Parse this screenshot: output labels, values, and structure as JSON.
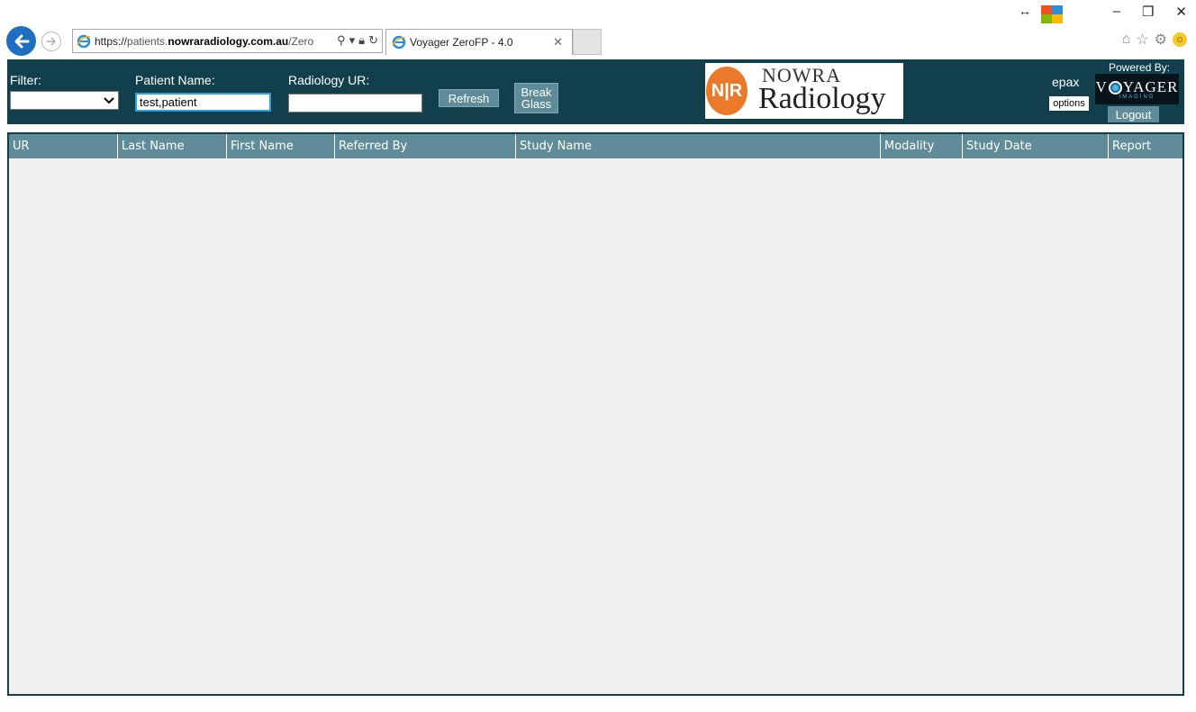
{
  "browser": {
    "url_scheme": "https://",
    "url_host_prefix": "patients.",
    "url_host": "nowraradiology.com.au",
    "url_path": "/Zero",
    "tab_title": "Voyager ZeroFP - 4.0"
  },
  "header": {
    "filter_label": "Filter:",
    "filter_value": "",
    "patient_name_label": "Patient Name:",
    "patient_name_value": "test,patient",
    "radiology_ur_label": "Radiology UR:",
    "radiology_ur_value": "",
    "refresh_label": "Refresh",
    "break_glass_line1": "Break",
    "break_glass_line2": "Glass",
    "logo_initials": "N|R",
    "logo_top": "NOWRA",
    "logo_main": "Radiology",
    "username": "epax",
    "options_label": "options",
    "powered_by": "Powered By:",
    "voyager_left": "V",
    "voyager_right": "YAGER",
    "voyager_sub": "IMAGING",
    "logout_label": "Logout"
  },
  "table": {
    "columns": [
      "UR",
      "Last Name",
      "First Name",
      "Referred By",
      "Study Name",
      "Modality",
      "Study Date",
      "Report"
    ],
    "rows": []
  },
  "colors": {
    "header_bg": "#123f4c",
    "column_header_bg": "#5f8c98",
    "button_bg": "#5f8c98",
    "logo_orange": "#ea7a2a"
  }
}
